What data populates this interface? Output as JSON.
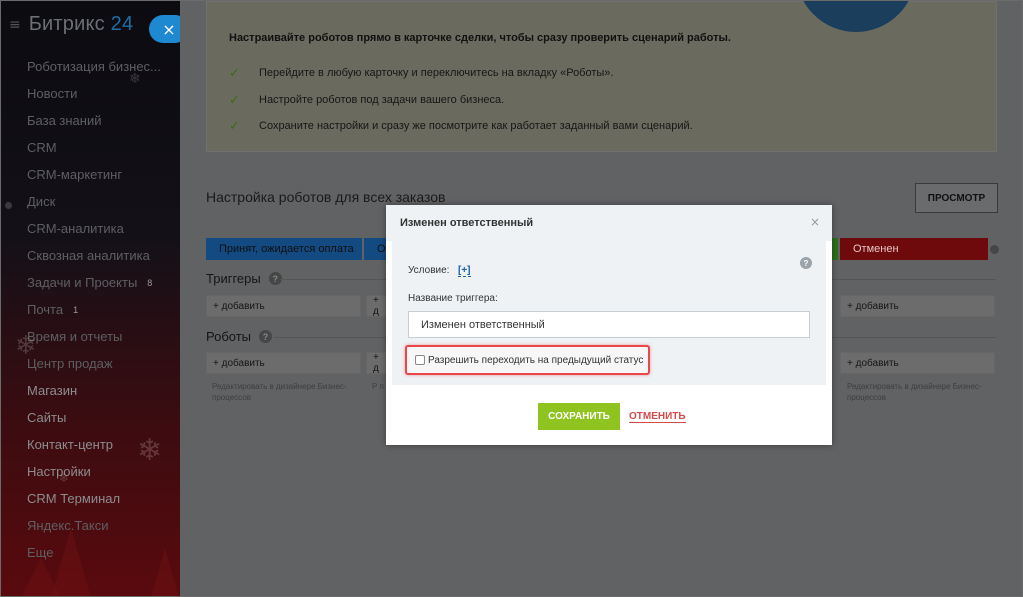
{
  "sidebar": {
    "logo_text": "Битрикс",
    "logo_num": "24",
    "items": [
      {
        "label": "Роботизация бизнес..."
      },
      {
        "label": "Новости"
      },
      {
        "label": "База знаний"
      },
      {
        "label": "CRM"
      },
      {
        "label": "CRM-маркетинг"
      },
      {
        "label": "Диск"
      },
      {
        "label": "CRM-аналитика"
      },
      {
        "label": "Сквозная аналитика"
      },
      {
        "label": "Задачи и Проекты",
        "count": "8"
      },
      {
        "label": "Почта",
        "count": "1"
      },
      {
        "label": "Время и отчеты"
      },
      {
        "label": "Центр продаж"
      },
      {
        "label": "Магазин"
      },
      {
        "label": "Сайты"
      },
      {
        "label": "Контакт-центр"
      },
      {
        "label": "Настройки"
      },
      {
        "label": "CRM Терминал"
      },
      {
        "label": "Яндекс.Такси"
      },
      {
        "label": "Еще"
      }
    ],
    "close_symbol": "×",
    "burger_symbol": "≡"
  },
  "info": {
    "heading": "Настраивайте роботов прямо в карточке сделки, чтобы сразу проверить сценарий работы.",
    "tips": [
      "Перейдите в любую карточку и переключитесь на вкладку «Роботы».",
      "Настройте роботов под задачи вашего бизнеса.",
      "Сохраните настройки и сразу же посмотрите как работает заданный вами сценарий."
    ],
    "check_symbol": "✓"
  },
  "robots": {
    "title": "Настройка роботов для всех заказов",
    "view_button": "ПРОСМОТР",
    "stages": {
      "first": "Принят, ожидается оплата",
      "second": "О",
      "last": "Отменен"
    },
    "triggers_label": "Триггеры",
    "robots_label": "Роботы",
    "help_symbol": "?",
    "add_label": "+ добавить",
    "add_short": "+ д",
    "hint": "Редактировать в дизайнере Бизнес-процессов",
    "hint_short": "Р п"
  },
  "modal": {
    "title": "Изменен ответственный",
    "close_symbol": "×",
    "condition_label": "Условие:",
    "condition_link": "[+]",
    "name_label": "Название триггера:",
    "name_value": "Изменен ответственный",
    "checkbox_label": "Разрешить переходить на предыдущий статус",
    "checkbox_checked": false,
    "save_button": "СОХРАНИТЬ",
    "cancel_link": "ОТМЕНИТЬ"
  },
  "colors": {
    "stage_blue": "#2066b0",
    "stage_red": "#d50c10",
    "save_green": "#8fc31f",
    "highlight_red": "#e8474c",
    "link_blue": "#1a5ea3"
  }
}
